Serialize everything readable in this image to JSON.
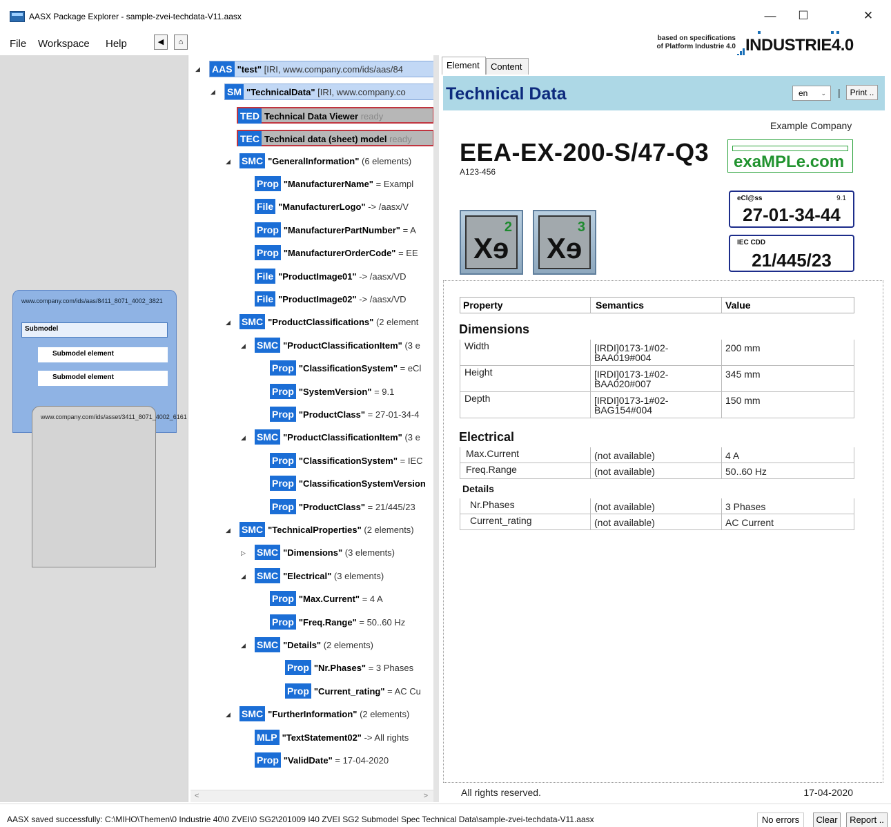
{
  "window": {
    "title": "AASX Package Explorer - sample-zvei-techdata-V11.aasx",
    "minimize_glyph": "—",
    "maximize_glyph": "☐",
    "close_glyph": "✕"
  },
  "menu": {
    "file": "File",
    "workspace": "Workspace",
    "help": "Help",
    "back_glyph": "◀",
    "home_glyph": "⌂"
  },
  "logo": {
    "line1": "based on specifications",
    "line2": "of Platform Industrie 4.0",
    "brand": "INDUSTRIE4.0",
    "brand_color": "#1b70b7"
  },
  "left_panel": {
    "aas_id": "www.company.com/ids/aas/8411_8071_4002_3821",
    "submodel_label": "Submodel",
    "submodel_element_1": "Submodel element",
    "submodel_element_2": "Submodel element",
    "asset_id": "www.company.com/ids/asset/3411_8071_4002_6161"
  },
  "tree": [
    {
      "tag": "AAS",
      "name": "\"test\"",
      "text": "[IRI, www.company.com/ids/aas/84",
      "expander": "◢"
    },
    {
      "tag": "SM",
      "name": "\"TechnicalData\"",
      "text": "[IRI, www.company.co",
      "expander": "◢"
    },
    {
      "tag": "TED",
      "name": "Technical Data Viewer",
      "text": "ready",
      "expander": ""
    },
    {
      "tag": "TEC",
      "name": "Technical data (sheet) model",
      "text": "ready",
      "expander": ""
    },
    {
      "tag": "SMC",
      "name": "\"GeneralInformation\"",
      "text": "(6 elements)",
      "expander": "◢"
    },
    {
      "tag": "Prop",
      "name": "\"ManufacturerName\"",
      "text": "= Exampl",
      "expander": ""
    },
    {
      "tag": "File",
      "name": "\"ManufacturerLogo\"",
      "text": "-> /aasx/V",
      "expander": ""
    },
    {
      "tag": "Prop",
      "name": "\"ManufacturerPartNumber\"",
      "text": "= A",
      "expander": ""
    },
    {
      "tag": "Prop",
      "name": "\"ManufacturerOrderCode\"",
      "text": "= EE",
      "expander": ""
    },
    {
      "tag": "File",
      "name": "\"ProductImage01\"",
      "text": "-> /aasx/VD",
      "expander": ""
    },
    {
      "tag": "File",
      "name": "\"ProductImage02\"",
      "text": "-> /aasx/VD",
      "expander": ""
    },
    {
      "tag": "SMC",
      "name": "\"ProductClassifications\"",
      "text": "(2 element",
      "expander": "◢"
    },
    {
      "tag": "SMC",
      "name": "\"ProductClassificationItem\"",
      "text": "(3 e",
      "expander": "◢"
    },
    {
      "tag": "Prop",
      "name": "\"ClassificationSystem\"",
      "text": "= eCl",
      "expander": ""
    },
    {
      "tag": "Prop",
      "name": "\"SystemVersion\"",
      "text": "= 9.1",
      "expander": ""
    },
    {
      "tag": "Prop",
      "name": "\"ProductClass\"",
      "text": "= 27-01-34-4",
      "expander": ""
    },
    {
      "tag": "SMC",
      "name": "\"ProductClassificationItem\"",
      "text": "(3 e",
      "expander": "◢"
    },
    {
      "tag": "Prop",
      "name": "\"ClassificationSystem\"",
      "text": "= IEC",
      "expander": ""
    },
    {
      "tag": "Prop",
      "name": "\"ClassificationSystemVersion",
      "text": "",
      "expander": ""
    },
    {
      "tag": "Prop",
      "name": "\"ProductClass\"",
      "text": "= 21/445/23",
      "expander": ""
    },
    {
      "tag": "SMC",
      "name": "\"TechnicalProperties\"",
      "text": "(2 elements)",
      "expander": "◢"
    },
    {
      "tag": "SMC",
      "name": "\"Dimensions\"",
      "text": "(3 elements)",
      "expander": "▷"
    },
    {
      "tag": "SMC",
      "name": "\"Electrical\"",
      "text": "(3 elements)",
      "expander": "◢"
    },
    {
      "tag": "Prop",
      "name": "\"Max.Current\"",
      "text": "= 4 A",
      "expander": ""
    },
    {
      "tag": "Prop",
      "name": "\"Freq.Range\"",
      "text": "= 50..60 Hz",
      "expander": ""
    },
    {
      "tag": "SMC",
      "name": "\"Details\"",
      "text": "(2 elements)",
      "expander": "◢"
    },
    {
      "tag": "Prop",
      "name": "\"Nr.Phases\"",
      "text": "= 3 Phases",
      "expander": ""
    },
    {
      "tag": "Prop",
      "name": "\"Current_rating\"",
      "text": "= AC Cu",
      "expander": ""
    },
    {
      "tag": "SMC",
      "name": "\"FurtherInformation\"",
      "text": "(2 elements)",
      "expander": "◢"
    },
    {
      "tag": "MLP",
      "name": "\"TextStatement02\"",
      "text": "-> All rights",
      "expander": ""
    },
    {
      "tag": "Prop",
      "name": "\"ValidDate\"",
      "text": "= 17-04-2020",
      "expander": ""
    }
  ],
  "tree_scroll": {
    "left": "<",
    "right": ">"
  },
  "tabs": {
    "element": "Element",
    "content": "Content"
  },
  "techdata": {
    "title": "Technical Data",
    "lang": "en",
    "lang_caret": "⌄",
    "separator": "|",
    "print": "Print ..",
    "company": "Example Company",
    "part_number": "EEA-EX-200-S/47-Q3",
    "order_code": "A123-456",
    "brand_logo_text": "exaMPLe.com",
    "xe_text": "Xɘ",
    "xe_sup_1": "2",
    "xe_sup_2": "3",
    "eclass_label": "eCl@ss",
    "eclass_version": "9.1",
    "eclass_value": "27-01-34-44",
    "iec_label": "IEC CDD",
    "iec_value": "21/445/23",
    "table_headers": {
      "property": "Property",
      "semantics": "Semantics",
      "value": "Value"
    },
    "sections": {
      "dimensions": "Dimensions",
      "electrical": "Electrical",
      "details": "Details"
    },
    "dimension_rows": [
      {
        "property": "Width",
        "semantics": "[IRDI]0173-1#02-BAA019#004",
        "value": "200 mm"
      },
      {
        "property": "Height",
        "semantics": "[IRDI]0173-1#02-BAA020#007",
        "value": "345 mm"
      },
      {
        "property": "Depth",
        "semantics": "[IRDI]0173-1#02-BAG154#004",
        "value": "150 mm"
      }
    ],
    "electrical_rows": [
      {
        "property": "Max.Current",
        "semantics": "(not available)",
        "value": "4 A"
      },
      {
        "property": "Freq.Range",
        "semantics": "(not available)",
        "value": "50..60 Hz"
      }
    ],
    "details_rows": [
      {
        "property": "Nr.Phases",
        "semantics": "(not available)",
        "value": "3 Phases"
      },
      {
        "property": "Current_rating",
        "semantics": "(not available)",
        "value": "AC Current"
      }
    ],
    "footer_left": "All rights reserved.",
    "footer_right": "17-04-2020"
  },
  "status": {
    "message": "AASX saved successfully: C:\\MIHO\\Themen\\0 Industrie 40\\0 ZVEI\\0 SG2\\201009 I40 ZVEI SG2 Submodel Spec Technical Data\\sample-zvei-techdata-V11.aasx",
    "errors": "No errors",
    "clear": "Clear",
    "report": "Report .."
  }
}
